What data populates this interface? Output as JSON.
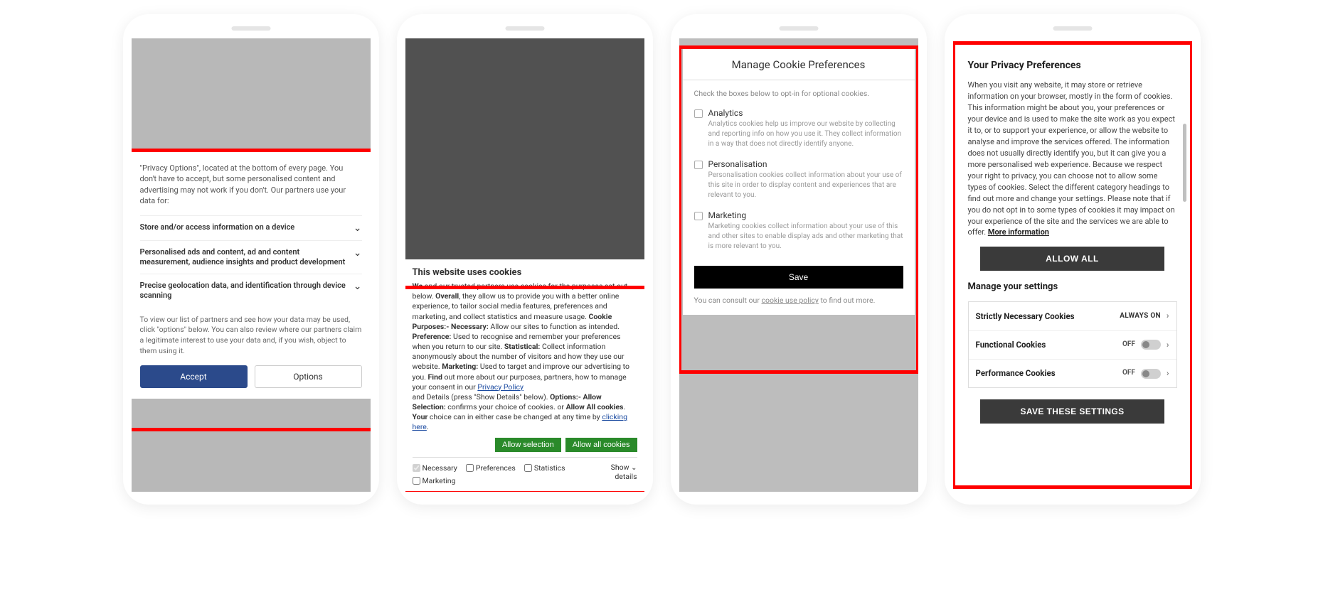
{
  "phone1": {
    "intro": "\"Privacy Options\", located at the bottom of every page. You don't have to accept, but some personalised content and advertising may not work if you don't. Our partners use your data for:",
    "sections": [
      "Store and/or access information on a device",
      "Personalised ads and content, ad and content measurement, audience insights and product development",
      "Precise geolocation data, and identification through device scanning"
    ],
    "footer": "To view our list of partners and see how your data may be used, click \"options\" below. You can also review where our partners claim a legitimate interest to use your data and, if you wish, object to them using it.",
    "accept": "Accept",
    "options": "Options"
  },
  "phone2": {
    "title": "This website uses cookies",
    "b1": "We",
    "t1": " and our trusted partners use cookies for the purposes set out below. ",
    "b2": "Overall",
    "t2": ", they allow us to provide you with a better online experience, to tailor social media features, preferences and marketing, and collect statistics and measure usage. ",
    "b3": "Cookie Purposes:- Necessary:",
    "t3": " Allow our sites to function as intended. ",
    "b4": "Preference:",
    "t4": " Used to recognise and remember your preferences when you return to our site. ",
    "b5": "Statistical:",
    "t5": " Collect information anonymously about the number of visitors and how they use our website. ",
    "b6": "Marketing:",
    "t6": " Used to target and improve our advertising to you. ",
    "b7": "Find",
    "t7": " out more about our purposes, partners, how to manage your consent in our ",
    "link1": "Privacy Policy",
    "t8": " and Details (press \"Show Details\" below). ",
    "b8": "Options:- Allow Selection:",
    "t9": " confirms your choice of cookies. or ",
    "b9": "Allow All cookies",
    "t10": ". ",
    "b10": "Your",
    "t11": " choice can in either case be changed at any time by ",
    "link2": "clicking here",
    "t12": ".",
    "allow_selection": "Allow selection",
    "allow_all": "Allow all cookies",
    "check_necessary": "Necessary",
    "check_preferences": "Preferences",
    "check_statistics": "Statistics",
    "check_marketing": "Marketing",
    "show": "Show",
    "details": "details"
  },
  "phone3": {
    "title": "Manage Cookie Preferences",
    "intro": "Check the boxes below to opt-in for optional cookies.",
    "items": [
      {
        "title": "Analytics",
        "desc": "Analytics cookies help us improve our website by collecting and reporting info on how you use it. They collect information in a way that does not directly identify anyone."
      },
      {
        "title": "Personalisation",
        "desc": "Personalisation cookies collect information about your use of this site in order to display content and experiences that are relevant to you."
      },
      {
        "title": "Marketing",
        "desc": "Marketing cookies collect information about your use of this and other sites to enable display ads and other marketing that is more relevant to you."
      }
    ],
    "save": "Save",
    "foot1": "You can consult our ",
    "foot_link": "cookie use policy",
    "foot2": " to find out more."
  },
  "phone4": {
    "title": "Your Privacy Preferences",
    "body": "When you visit any website, it may store or retrieve information on your browser, mostly in the form of cookies. This information might be about you, your preferences or your device and is used to make the site work as you expect it to, or to support your experience, or allow the website to analyse and improve the services offered. The information does not usually directly identify you, but it can give you a more personalised web experience. Because we respect your right to privacy, you can choose not to allow some types of cookies. Select the different category headings to find out more and change your settings. Please note that if you do not opt in to some types of cookies it may impact on your experience of the site and the services we are able to offer.  ",
    "more_info": "More information",
    "allow_all": "ALLOW ALL",
    "manage_title": "Manage your settings",
    "rows": [
      {
        "label": "Strictly Necessary Cookies",
        "state": "ALWAYS ON",
        "always": true
      },
      {
        "label": "Functional Cookies",
        "state": "OFF",
        "always": false
      },
      {
        "label": "Performance Cookies",
        "state": "OFF",
        "always": false
      }
    ],
    "save": "SAVE THESE SETTINGS"
  }
}
